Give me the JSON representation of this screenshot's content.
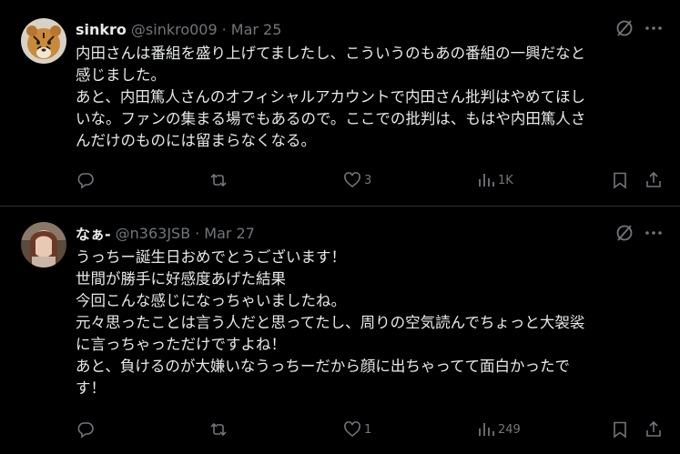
{
  "tweets": [
    {
      "name": "sinkro",
      "handle": "@sinkro009",
      "separator": "·",
      "date": "Mar 25",
      "lines": [
        "内田さんは番組を盛り上げてましたし、こういうのもあの番組の一興だなと",
        "感じました。",
        "あと、内田篤人さんのオフィシャルアカウントで内田さん批判はやめてほし",
        "いな。ファンの集まる場でもあるので。ここでの批判は、もはや内田篤人さ",
        "んだけのものには留まらなくなる。"
      ],
      "likes": "3",
      "views": "1K",
      "avatar": "tiger-avatar"
    },
    {
      "name": "なぁ-",
      "handle": "@n363JSB",
      "separator": "·",
      "date": "Mar 27",
      "lines": [
        "うっちー誕生日おめでとうございます！",
        "世間が勝手に好感度あげた結果",
        "今回こんな感じになっちゃいましたね。",
        "元々思ったことは言う人だと思ってたし、周りの空気読んでちょっと大袈裟",
        "に言っちゃっただけですよね！",
        "あと、負けるのが大嫌いなうっちーだから顔に出ちゃってて面白かったで",
        "す！"
      ],
      "likes": "1",
      "views": "249",
      "avatar": "portrait-avatar"
    }
  ],
  "colors": {
    "background": "#000000",
    "text": "#e7e9ea",
    "muted": "#71767b",
    "divider": "#2f3336"
  },
  "icons": [
    "grok-icon",
    "more-icon",
    "reply-icon",
    "retweet-icon",
    "like-icon",
    "views-icon",
    "bookmark-icon",
    "share-icon"
  ]
}
